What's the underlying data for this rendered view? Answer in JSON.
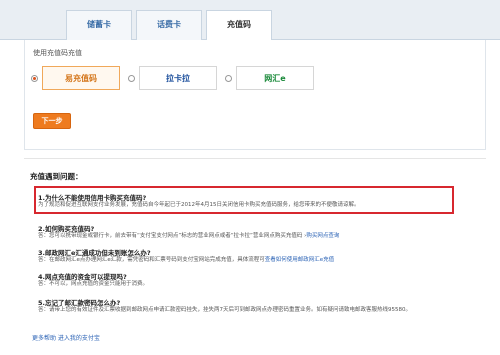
{
  "tabs": [
    {
      "label": "储蓄卡"
    },
    {
      "label": "话费卡"
    },
    {
      "label": "充值码"
    }
  ],
  "panel": {
    "title": "使用充值码充值",
    "options": [
      {
        "label": "易充值码",
        "icon": "recharge-code-logo"
      },
      {
        "label": "拉卡拉",
        "icon": "lakala-logo"
      },
      {
        "label": "网汇e",
        "icon": "wanghui-e-logo"
      }
    ],
    "selected": "易充值码",
    "next_button": "下一步"
  },
  "faq": {
    "title": "充值遇到问题：",
    "items": [
      {
        "q": "1.为什么不能使用信用卡购买充值码?",
        "a": "为了规范和促进互联网支付业务发展，充值码自今年起已于2012年4月15日关闭信用卡购买充值码服务，给您带来的不便敬请谅解。",
        "link": ""
      },
      {
        "q": "2.如何购买充值码?",
        "a": "答：您可以携带现金或银行卡，前去带有“支付宝支付网点”标志的营业网点或者“拉卡拉”营业网点购买充值码 ›",
        "link": "购买网点查询"
      },
      {
        "q": "3.邮政网汇e汇通成功但未到账怎么办?",
        "a": "答：在邮政网汇e点办理网汇e汇款，需凭密码和汇票号码到支付宝网站完成充值，具体流程可",
        "link": "查看如何使用邮政网汇e充值"
      },
      {
        "q": "4.网点充值的资金可以提现吗?",
        "a": "答：不可以，网点充值的资金只能用于消费。",
        "link": ""
      },
      {
        "q": "5.忘记了邮汇款密码怎么办?",
        "a": "答：请带上您的有效证件及汇票收据到邮政网点申请汇款密码挂失，挂失两7天后可到邮政网点办理密码重置业务。如有疑问请致电邮政客服热线95580。",
        "link": ""
      }
    ],
    "more_link": "更多帮助 进入我的支付宝"
  }
}
